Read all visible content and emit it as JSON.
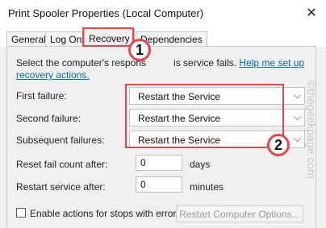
{
  "window": {
    "title": "Print Spooler Properties (Local Computer)",
    "close_glyph": "✕"
  },
  "tabs": [
    {
      "label": "General",
      "active": false
    },
    {
      "label": "Log On",
      "active": false
    },
    {
      "label": "Recovery",
      "active": true
    },
    {
      "label": "Dependencies",
      "active": false
    }
  ],
  "recovery": {
    "description_text": "Select the computer's respons",
    "description_text2": "is service fails.",
    "help_link": "Help me set up recovery actions.",
    "first_failure": {
      "label": "First failure:",
      "value": "Restart the Service"
    },
    "second_failure": {
      "label": "Second failure:",
      "value": "Restart the Service"
    },
    "subsequent_failures": {
      "label": "Subsequent failures:",
      "value": "Restart the Service"
    },
    "reset_fail_count": {
      "label": "Reset fail count after:",
      "value": "0",
      "unit": "days"
    },
    "restart_service": {
      "label": "Restart service after:",
      "value": "0",
      "unit": "minutes"
    },
    "enable_actions_checkbox": {
      "label": "Enable actions for stops with errors.",
      "checked": false
    },
    "restart_computer_options_button": "Restart Computer Options..."
  },
  "annotations": {
    "badge_1": "1",
    "badge_2": "2",
    "accent_color": "#e8454c"
  },
  "watermark": "©thegeekpage.com",
  "colors": {
    "link": "#0067c0",
    "highlight": "#e8454c"
  }
}
